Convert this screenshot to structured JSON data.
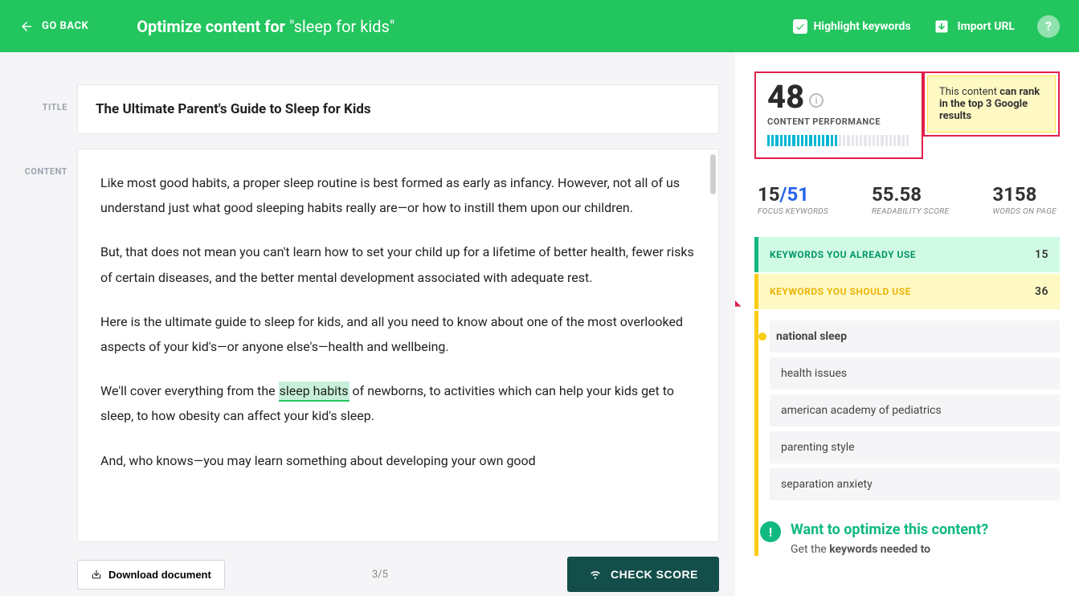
{
  "topbar": {
    "go_back": "GO BACK",
    "title_prefix": "Optimize content for ",
    "title_query": "\"sleep for kids\"",
    "highlight_keywords": "Highlight keywords",
    "import_url": "Import URL",
    "help": "?"
  },
  "labels": {
    "title": "TITLE",
    "content": "CONTENT"
  },
  "editor": {
    "title": "The Ultimate Parent's Guide to Sleep for Kids",
    "p1": "Like most good habits, a proper sleep routine is best formed as early as infancy. However, not all of us understand just what good sleeping habits really are—or how to instill them upon our children.",
    "p2": "But, that does not mean you can't learn how to set your child up for a lifetime of better health, fewer risks of certain diseases, and the better mental development associated with adequate rest.",
    "p3": "Here is the ultimate guide to sleep for kids, and all you need to know about one of the most overlooked aspects of your kid's—or anyone else's—health and wellbeing.",
    "p4a": "We'll cover everything from the ",
    "p4_hl": "sleep habits",
    "p4b": " of newborns, to activities which can help your kids get to sleep, to how obesity can affect your kid's sleep.",
    "p5": "And, who knows—you may learn something about developing your own good"
  },
  "bottom": {
    "download": "Download document",
    "page": "3/5",
    "check_score": "CHECK SCORE"
  },
  "score": {
    "value": "48",
    "label": "CONTENT PERFORMANCE",
    "rank_text_a": "This content ",
    "rank_text_b": "can rank in the top 3 Google results"
  },
  "stats": {
    "focus_used": "15",
    "focus_sep": "/",
    "focus_total": "51",
    "focus_label": "FOCUS KEYWORDS",
    "readability": "55.58",
    "readability_label": "READABILITY SCORE",
    "words": "3158",
    "words_label": "WORDS ON PAGE"
  },
  "keywords": {
    "already_label": "KEYWORDS YOU ALREADY USE",
    "already_count": "15",
    "should_label": "KEYWORDS YOU SHOULD USE",
    "should_count": "36",
    "items": {
      "0": "national sleep",
      "1": "health issues",
      "2": "american academy of pediatrics",
      "3": "parenting style",
      "4": "separation anxiety"
    }
  },
  "cta": {
    "title": "Want to optimize this content?",
    "text_a": "Get the ",
    "text_b": "keywords needed to"
  }
}
